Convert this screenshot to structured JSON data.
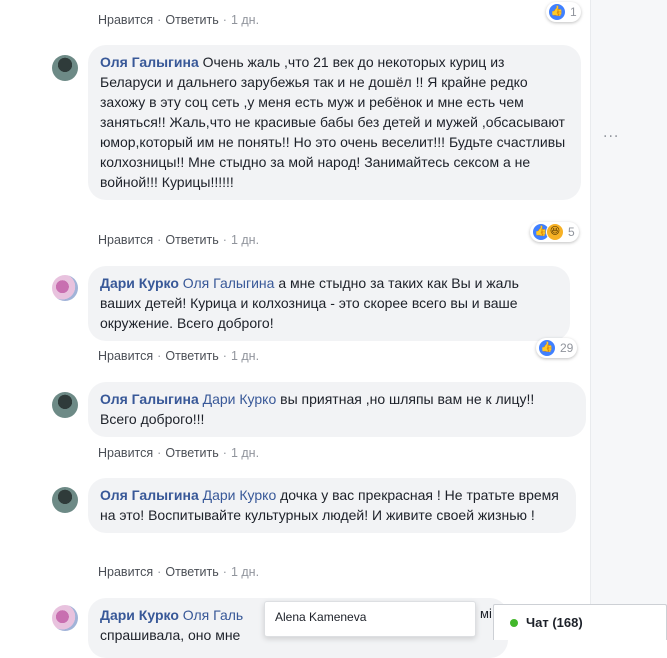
{
  "actions": {
    "like": "Нравится",
    "reply": "Ответить",
    "sep": "·"
  },
  "top_row": {
    "time": "1 дн.",
    "reactions": "1"
  },
  "comments": [
    {
      "author": "Оля Галыгина",
      "text": "Очень жаль ,что 21 век до некоторых куриц из Беларуси и дальнего зарубежья так и не дошёл !! Я крайне редко захожу в эту соц сеть ,у меня есть муж и ребёнок и мне есть чем заняться!! Жаль,что не красивые бабы без детей и мужей ,обсасывают юмор,который им не понять!! Но это очень веселит!!! Будьте счастливы колхозницы!! Мне стыдно за мой народ! Занимайтесь сексом а не войной!!! Курицы!!!!!!",
      "time": "1 дн.",
      "reactions": "5"
    },
    {
      "author": "Дари Курко",
      "mention": "Оля Галыгина",
      "text": "а мне стыдно за таких как Вы и жаль ваших детей! Курица и колхозница - это скорее всего вы и ваше окружение. Всего доброго!",
      "time": "1 дн.",
      "reactions": "29"
    },
    {
      "author": "Оля Галыгина",
      "mention": "Дари Курко",
      "text": "вы приятная ,но шляпы вам не к лицу!! Всего доброго!!!",
      "time": "1 дн."
    },
    {
      "author": "Оля Галыгина",
      "mention": "Дари Курко",
      "text": "дочка у вас прекрасная ! Не тратьте время на это! Воспитывайте культурных людей! И живите своей жизнью !",
      "time": "1 дн."
    },
    {
      "author": "Дари Курко",
      "mention": "Оля Галь",
      "text_line2": "спрашивала, оно мне",
      "text_tail": "мі"
    }
  ],
  "tooltip": {
    "name": "Alena Kameneva"
  },
  "chat": {
    "label": "Чат (168)",
    "status_color": "#42b72a"
  },
  "colors": {
    "link_blue": "#385898",
    "bubble_bg": "#f2f3f5",
    "like_blue": "#4080ff",
    "muted": "#90949c"
  }
}
